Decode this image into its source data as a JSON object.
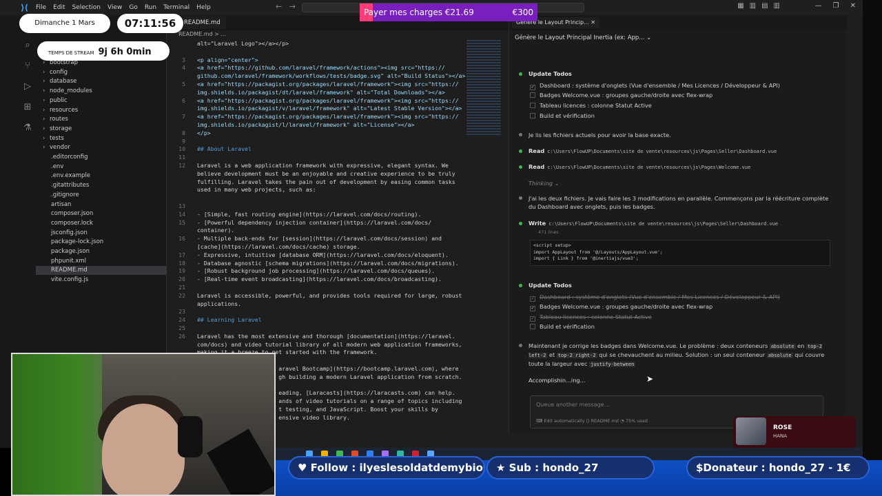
{
  "titlebar": {
    "menu": [
      "File",
      "Edit",
      "Selection",
      "View",
      "Go",
      "Run",
      "Terminal",
      "Help"
    ]
  },
  "explorer": {
    "items": [
      {
        "label": "bootstrap",
        "folder": true
      },
      {
        "label": "config",
        "folder": true
      },
      {
        "label": "database",
        "folder": true
      },
      {
        "label": "node_modules",
        "folder": true
      },
      {
        "label": "public",
        "folder": true
      },
      {
        "label": "resources",
        "folder": true
      },
      {
        "label": "routes",
        "folder": true
      },
      {
        "label": "storage",
        "folder": true
      },
      {
        "label": "tests",
        "folder": true
      },
      {
        "label": "vendor",
        "folder": true
      },
      {
        "label": ".editorconfig",
        "folder": false
      },
      {
        "label": ".env",
        "folder": false
      },
      {
        "label": ".env.example",
        "folder": false
      },
      {
        "label": ".gitattributes",
        "folder": false
      },
      {
        "label": ".gitignore",
        "folder": false
      },
      {
        "label": "artisan",
        "folder": false
      },
      {
        "label": "composer.json",
        "folder": false
      },
      {
        "label": "composer.lock",
        "folder": false
      },
      {
        "label": "jsconfig.json",
        "folder": false
      },
      {
        "label": "package-lock.json",
        "folder": false
      },
      {
        "label": "package.json",
        "folder": false
      },
      {
        "label": "phpunit.xml",
        "folder": false
      },
      {
        "label": "README.md",
        "folder": false,
        "selected": true
      },
      {
        "label": "vite.config.js",
        "folder": false
      }
    ]
  },
  "editor": {
    "tab": "README.md",
    "breadcrumb": "README.md > ...",
    "lines": [
      {
        "n": "",
        "t": "alt=\"Laravel Logo\"></a></p>"
      },
      {
        "n": "",
        "t": ""
      },
      {
        "n": "3",
        "t": "<p align=\"center\">"
      },
      {
        "n": "4",
        "t": "<a href=\"https://github.com/laravel/framework/actions\"><img src=\"https://"
      },
      {
        "n": "",
        "t": "github.com/laravel/framework/workflows/tests/badge.svg\" alt=\"Build Status\"></a>"
      },
      {
        "n": "5",
        "t": "<a href=\"https://packagist.org/packages/laravel/framework\"><img src=\"https://"
      },
      {
        "n": "",
        "t": "img.shields.io/packagist/dt/laravel/framework\" alt=\"Total Downloads\"></a>"
      },
      {
        "n": "6",
        "t": "<a href=\"https://packagist.org/packages/laravel/framework\"><img src=\"https://"
      },
      {
        "n": "",
        "t": "img.shields.io/packagist/v/laravel/framework\" alt=\"Latest Stable Version\"></a>"
      },
      {
        "n": "7",
        "t": "<a href=\"https://packagist.org/packages/laravel/framework\"><img src=\"https://"
      },
      {
        "n": "",
        "t": "img.shields.io/packagist/l/laravel/framework\" alt=\"License\"></a>"
      },
      {
        "n": "8",
        "t": "</p>"
      },
      {
        "n": "9",
        "t": ""
      },
      {
        "n": "10",
        "t": "## About Laravel"
      },
      {
        "n": "11",
        "t": ""
      },
      {
        "n": "12",
        "t": "Laravel is a web application framework with expressive, elegant syntax. We"
      },
      {
        "n": "",
        "t": "believe development must be an enjoyable and creative experience to be truly"
      },
      {
        "n": "",
        "t": "fulfilling. Laravel takes the pain out of development by easing common tasks"
      },
      {
        "n": "",
        "t": "used in many web projects, such as:"
      },
      {
        "n": "",
        "t": ""
      },
      {
        "n": "13",
        "t": ""
      },
      {
        "n": "14",
        "t": "- [Simple, fast routing engine](https://laravel.com/docs/routing)."
      },
      {
        "n": "15",
        "t": "- [Powerful dependency injection container](https://laravel.com/docs/"
      },
      {
        "n": "",
        "t": "container)."
      },
      {
        "n": "16",
        "t": "- Multiple back-ends for [session](https://laravel.com/docs/session) and"
      },
      {
        "n": "",
        "t": "[cache](https://laravel.com/docs/cache) storage."
      },
      {
        "n": "17",
        "t": "- Expressive, intuitive [database ORM](https://laravel.com/docs/eloquent)."
      },
      {
        "n": "18",
        "t": "- Database agnostic [schema migrations](https://laravel.com/docs/migrations)."
      },
      {
        "n": "19",
        "t": "- [Robust background job processing](https://laravel.com/docs/queues)."
      },
      {
        "n": "20",
        "t": "- [Real-time event broadcasting](https://laravel.com/docs/broadcasting)."
      },
      {
        "n": "21",
        "t": ""
      },
      {
        "n": "22",
        "t": "Laravel is accessible, powerful, and provides tools required for large, robust"
      },
      {
        "n": "",
        "t": "applications."
      },
      {
        "n": "23",
        "t": ""
      },
      {
        "n": "24",
        "t": "## Learning Laravel"
      },
      {
        "n": "25",
        "t": ""
      },
      {
        "n": "26",
        "t": "Laravel has the most extensive and thorough [documentation](https://laravel."
      },
      {
        "n": "",
        "t": "com/docs) and video tutorial library of all modern web application frameworks,"
      },
      {
        "n": "",
        "t": "making it a breeze to get started with the framework."
      },
      {
        "n": "",
        "t": ""
      },
      {
        "n": "",
        "t": "                        aravel Bootcamp](https://bootcamp.laravel.com), where"
      },
      {
        "n": "",
        "t": "                        gh building a modern Laravel application from scratch."
      },
      {
        "n": "",
        "t": ""
      },
      {
        "n": "",
        "t": "                        eading, [Laracasts](https://laracasts.com) can help."
      },
      {
        "n": "",
        "t": "                        ands of video tutorials on a range of topics including"
      },
      {
        "n": "",
        "t": "                        t testing, and JavaScript. Boost your skills by"
      },
      {
        "n": "",
        "t": "                        ensive video library."
      }
    ]
  },
  "chat": {
    "tab_title": "Génère le Layout Princip...",
    "header": "Génère le Layout Principal Inertia (ex: App...",
    "todos1_title": "Update Todos",
    "todos1": [
      "Dashboard : système d'onglets (Vue d'ensemble / Mes Licences / Développeur & API)",
      "Badges Welcome.vue : groupes gauche/droite avec flex-wrap",
      "Tableau licences : colonne Statut Active",
      "Build et vérification"
    ],
    "msg_read_intro": "Je lis les fichiers actuels pour avoir la base exacte.",
    "read_label": "Read",
    "read1_path": "c:\\Users\\FlowUP\\Documents\\site de vente\\resources\\js\\Pages\\Seller\\Dashboard.vue",
    "read2_path": "c:\\Users\\FlowUP\\Documents\\site de vente\\resources\\js\\Pages\\Welcome.vue",
    "thinking": "Thinking ⌄",
    "msg_plan": "J'ai les deux fichiers. Je vais faire les 3 modifications en parallèle. Commençons par la réécriture complète du Dashboard avec onglets, puis les badges.",
    "write_label": "Write",
    "write_path": "c:\\Users\\FlowUP\\Documents\\site de vente\\resources\\js\\Pages\\Seller\\Dashboard.vue",
    "write_lines_count": "471 lines",
    "code": [
      "<script setup>",
      "import AppLayout from '@/Layouts/AppLayout.vue';",
      "import { Link } from '@inertiajs/vue3';"
    ],
    "todos2_title": "Update Todos",
    "todos2": [
      "Dashboard : système d'onglets (Vue d'ensemble / Mes Licences / Développeur & API)",
      "Badges Welcome.vue : groupes gauche/droite avec flex-wrap",
      "Tableau licences : colonne Statut Active",
      "Build et vérification"
    ],
    "msg_fix_1": "Maintenant je corrige les badges dans Welcome.vue. Le problème : deux conteneurs",
    "msg_fix_code1": "absolute",
    "msg_fix_2": "en",
    "msg_fix_code2": "top-2 left-2",
    "msg_fix_3": "et",
    "msg_fix_code3": "top-2 right-2",
    "msg_fix_4": "qui se chevauchent au milieu. Solution : un seul conteneur",
    "msg_fix_code4": "absolute",
    "msg_fix_5": "qui couvre toute la largeur avec",
    "msg_fix_code5": "justify-between",
    "status": "Accomplishin...ing...",
    "input_placeholder": "Queue another message...",
    "input_meta": "⌨ Edit automatically   ⟨⟩ README.md   ◔ 75% used"
  },
  "overlay": {
    "date": "Dimanche 1 Mars",
    "clock": "07:11:56",
    "stream_label": "TEMPS DE STREAM",
    "stream_value": "9j 6h 0min",
    "goal_label": "Payer mes charges €21.69",
    "goal_target": "€300",
    "goal_progress": 0.0723,
    "follow": "♥ Follow : ilyeslesoldatdemybios",
    "sub": "★ Sub : hondo_27",
    "donor": "$Donateur : hondo_27 - 1€",
    "song_title": "ROSE",
    "song_artist": "HANA"
  },
  "colors": {
    "accent_green": "#3fb950",
    "goal_bg": "#7a1fbf",
    "goal_fill": "#ff3b7a",
    "banner_blue": "#162f6e"
  }
}
